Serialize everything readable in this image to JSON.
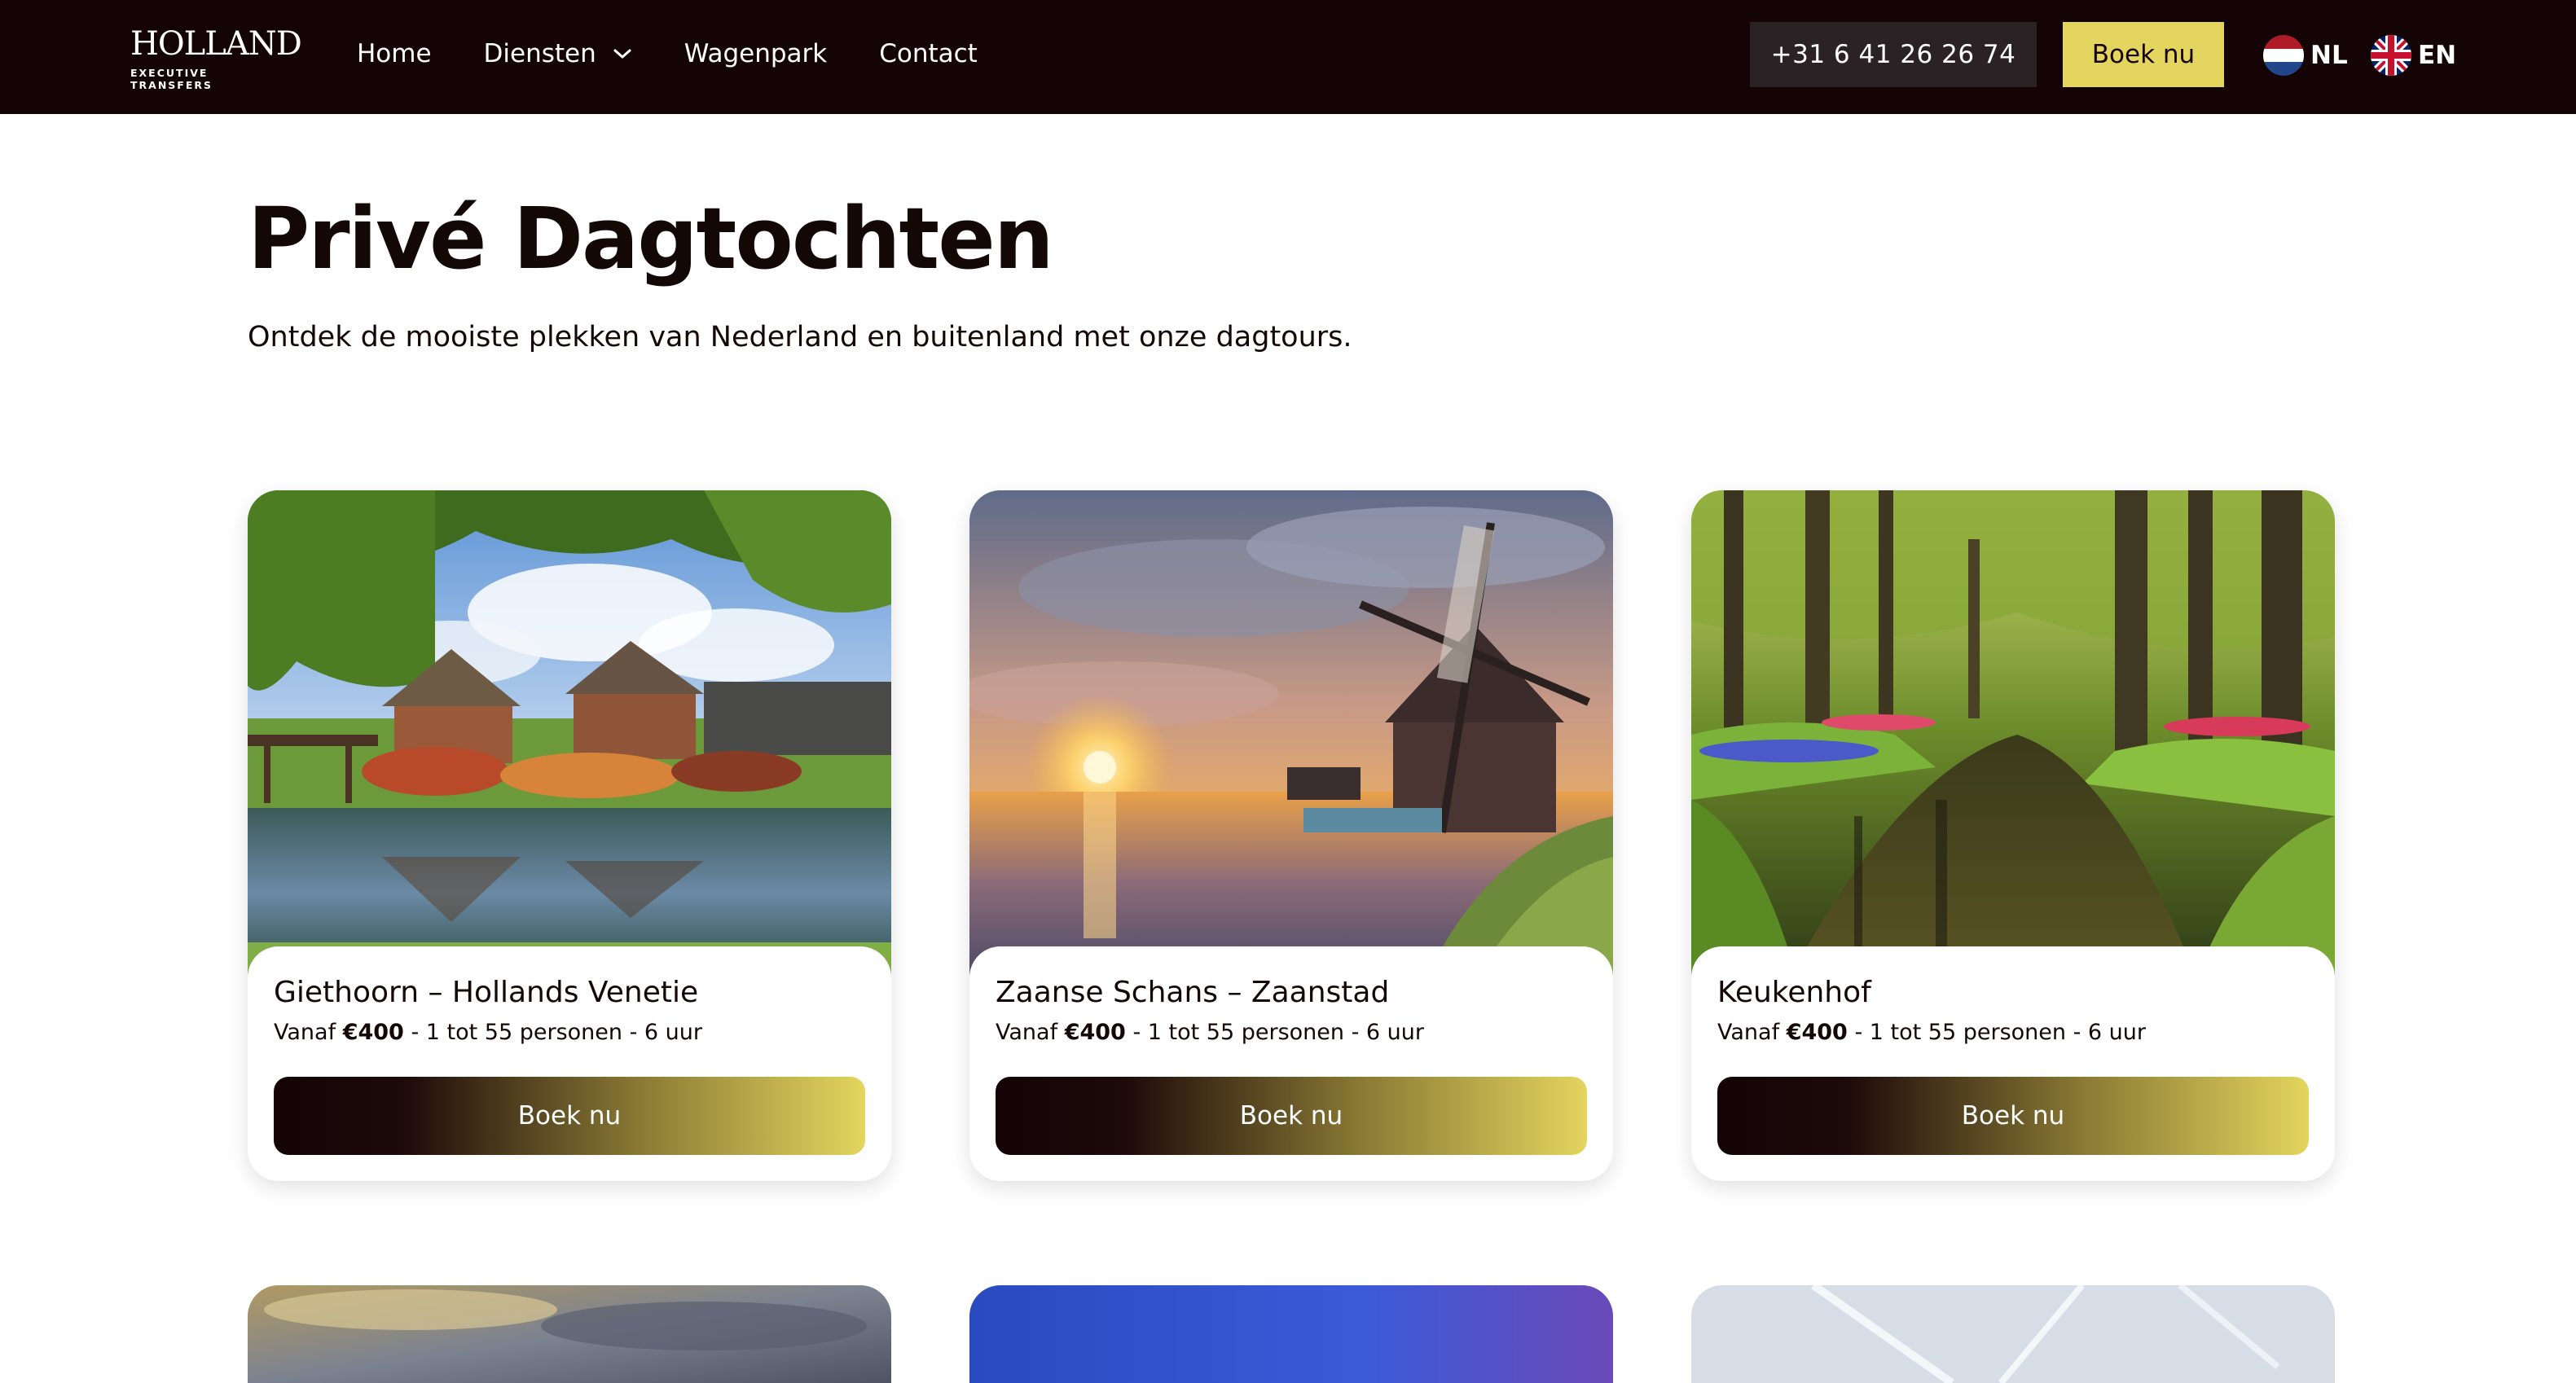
{
  "header": {
    "logo_main": "HOLLAND",
    "logo_sub": "EXECUTIVE TRANSFERS",
    "nav": [
      {
        "label": "Home"
      },
      {
        "label": "Diensten",
        "icon": "chevron-down-icon"
      },
      {
        "label": "Wagenpark"
      },
      {
        "label": "Contact"
      }
    ],
    "phone": "+31 6 41 26 26 74",
    "book_label": "Boek nu",
    "languages": [
      {
        "code": "NL",
        "icon": "flag-nl-icon"
      },
      {
        "code": "EN",
        "icon": "flag-uk-icon"
      }
    ]
  },
  "intro": {
    "title": "Privé Dagtochten",
    "subtitle": "Ontdek de mooiste plekken van Nederland en buitenland met onze dagtours."
  },
  "tours": [
    {
      "title": "Giethoorn – Hollands Venetie",
      "price_prefix": "Vanaf",
      "price": "€400",
      "details": "- 1 tot 55 personen - 6 uur",
      "button": "Boek nu",
      "image": "giethoorn-photo"
    },
    {
      "title": "Zaanse Schans – Zaanstad",
      "price_prefix": "Vanaf",
      "price": "€400",
      "details": "- 1 tot 55 personen - 6 uur",
      "button": "Boek nu",
      "image": "zaanse-schans-windmill-photo"
    },
    {
      "title": "Keukenhof",
      "price_prefix": "Vanaf",
      "price": "€400",
      "details": "- 1 tot 55 personen - 6 uur",
      "button": "Boek nu",
      "image": "keukenhof-garden-photo"
    }
  ],
  "colors": {
    "header_bg": "#140406",
    "accent_yellow": "#e3d55e",
    "phone_bg": "#2a2224",
    "text_dark": "#140806"
  }
}
